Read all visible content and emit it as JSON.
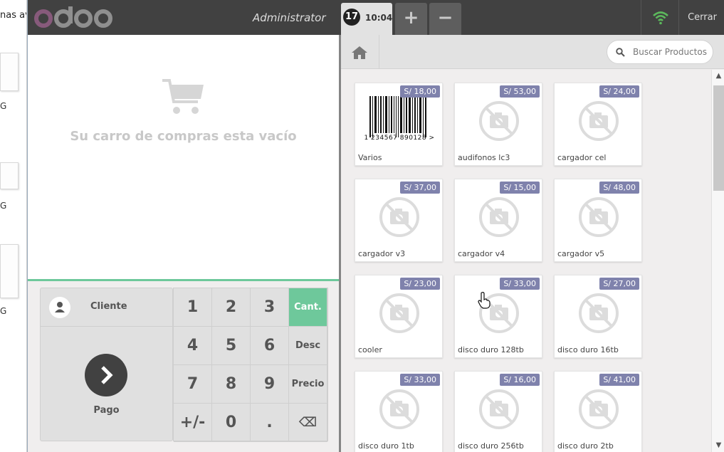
{
  "background_window": {
    "fragment": "nas av",
    "g_labels": [
      "G",
      "G",
      "G"
    ]
  },
  "header": {
    "brand": "odoo",
    "user": "Administrator",
    "order": {
      "number": "17",
      "time": "10:04"
    },
    "add_order": "+",
    "remove_order": "−",
    "close": "Cerrar",
    "wifi_color": "#5cb85c"
  },
  "cart": {
    "empty_message": "Su carro de compras esta vacío"
  },
  "actionpad": {
    "customer": "Cliente",
    "payment": "Pago"
  },
  "numpad": {
    "keys": [
      "1",
      "2",
      "3",
      "Cant.",
      "4",
      "5",
      "6",
      "Desc",
      "7",
      "8",
      "9",
      "Precio",
      "+/-",
      "0",
      ".",
      "⌫"
    ],
    "active_mode": "Cant."
  },
  "search": {
    "placeholder": "Buscar Productos"
  },
  "products": [
    {
      "name": "Varios",
      "price": "S/ 18,00",
      "barcode": "1 234567 890128 >"
    },
    {
      "name": "audifonos lc3",
      "price": "S/ 53,00"
    },
    {
      "name": "cargador cel",
      "price": "S/ 24,00"
    },
    {
      "name": "cargador v3",
      "price": "S/ 37,00"
    },
    {
      "name": "cargador v4",
      "price": "S/ 15,00"
    },
    {
      "name": "cargador v5",
      "price": "S/ 48,00"
    },
    {
      "name": "cooler",
      "price": "S/ 23,00"
    },
    {
      "name": "disco duro 128tb",
      "price": "S/ 33,00"
    },
    {
      "name": "disco duro 16tb",
      "price": "S/ 27,00"
    },
    {
      "name": "disco duro 1tb",
      "price": "S/ 33,00"
    },
    {
      "name": "disco duro 256tb",
      "price": "S/ 16,00"
    },
    {
      "name": "disco duro 2tb",
      "price": "S/ 41,00"
    }
  ],
  "colors": {
    "accent": "#6ec89b",
    "price_badge": "#7f82ac",
    "topbar": "#414141",
    "brand": "#875a7b"
  }
}
